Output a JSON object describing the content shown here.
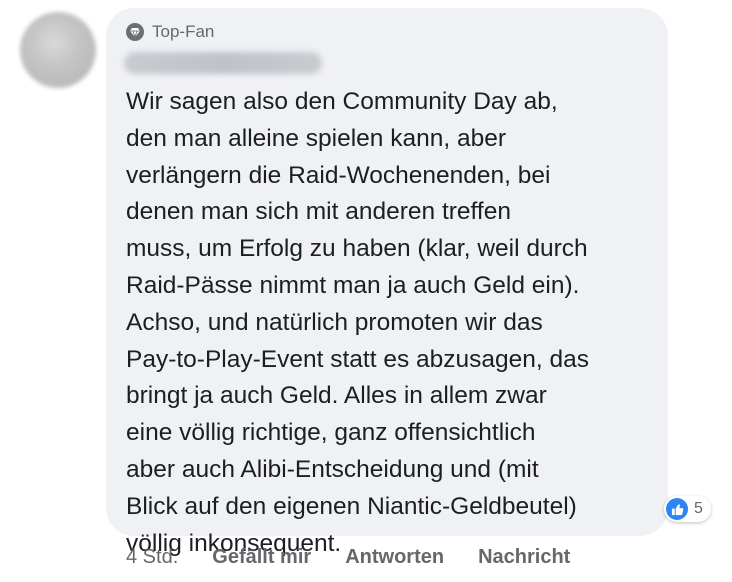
{
  "comment": {
    "badge_label": "Top-Fan",
    "badge_icon": "diamond-icon",
    "author_name_redacted": true,
    "text_lines": [
      "Wir sagen also den Community Day ab,",
      "den man alleine spielen kann, aber",
      "verlängern die Raid-Wochenenden, bei",
      "denen man sich mit anderen treffen",
      "muss, um Erfolg zu haben (klar, weil durch",
      "Raid-Pässe nimmt man ja auch Geld ein).",
      "Achso, und natürlich promoten wir das",
      "Pay-to-Play-Event statt es abzusagen, das",
      "bringt ja auch Geld. Alles in allem zwar",
      "eine völlig richtige, ganz offensichtlich",
      "aber auch Alibi-Entscheidung und (mit",
      "Blick auf den eigenen Niantic-Geldbeutel)",
      "völlig inkonsequent."
    ],
    "reactions": {
      "icon": "like-icon",
      "count": "5",
      "color": "#2e83f5"
    }
  },
  "actions": {
    "time": "4 Std.",
    "like": "Gefällt mir",
    "reply": "Antworten",
    "message": "Nachricht"
  },
  "colors": {
    "bubble_bg": "#f0f1f4",
    "text": "#1c1e21",
    "secondary": "#65676b"
  }
}
